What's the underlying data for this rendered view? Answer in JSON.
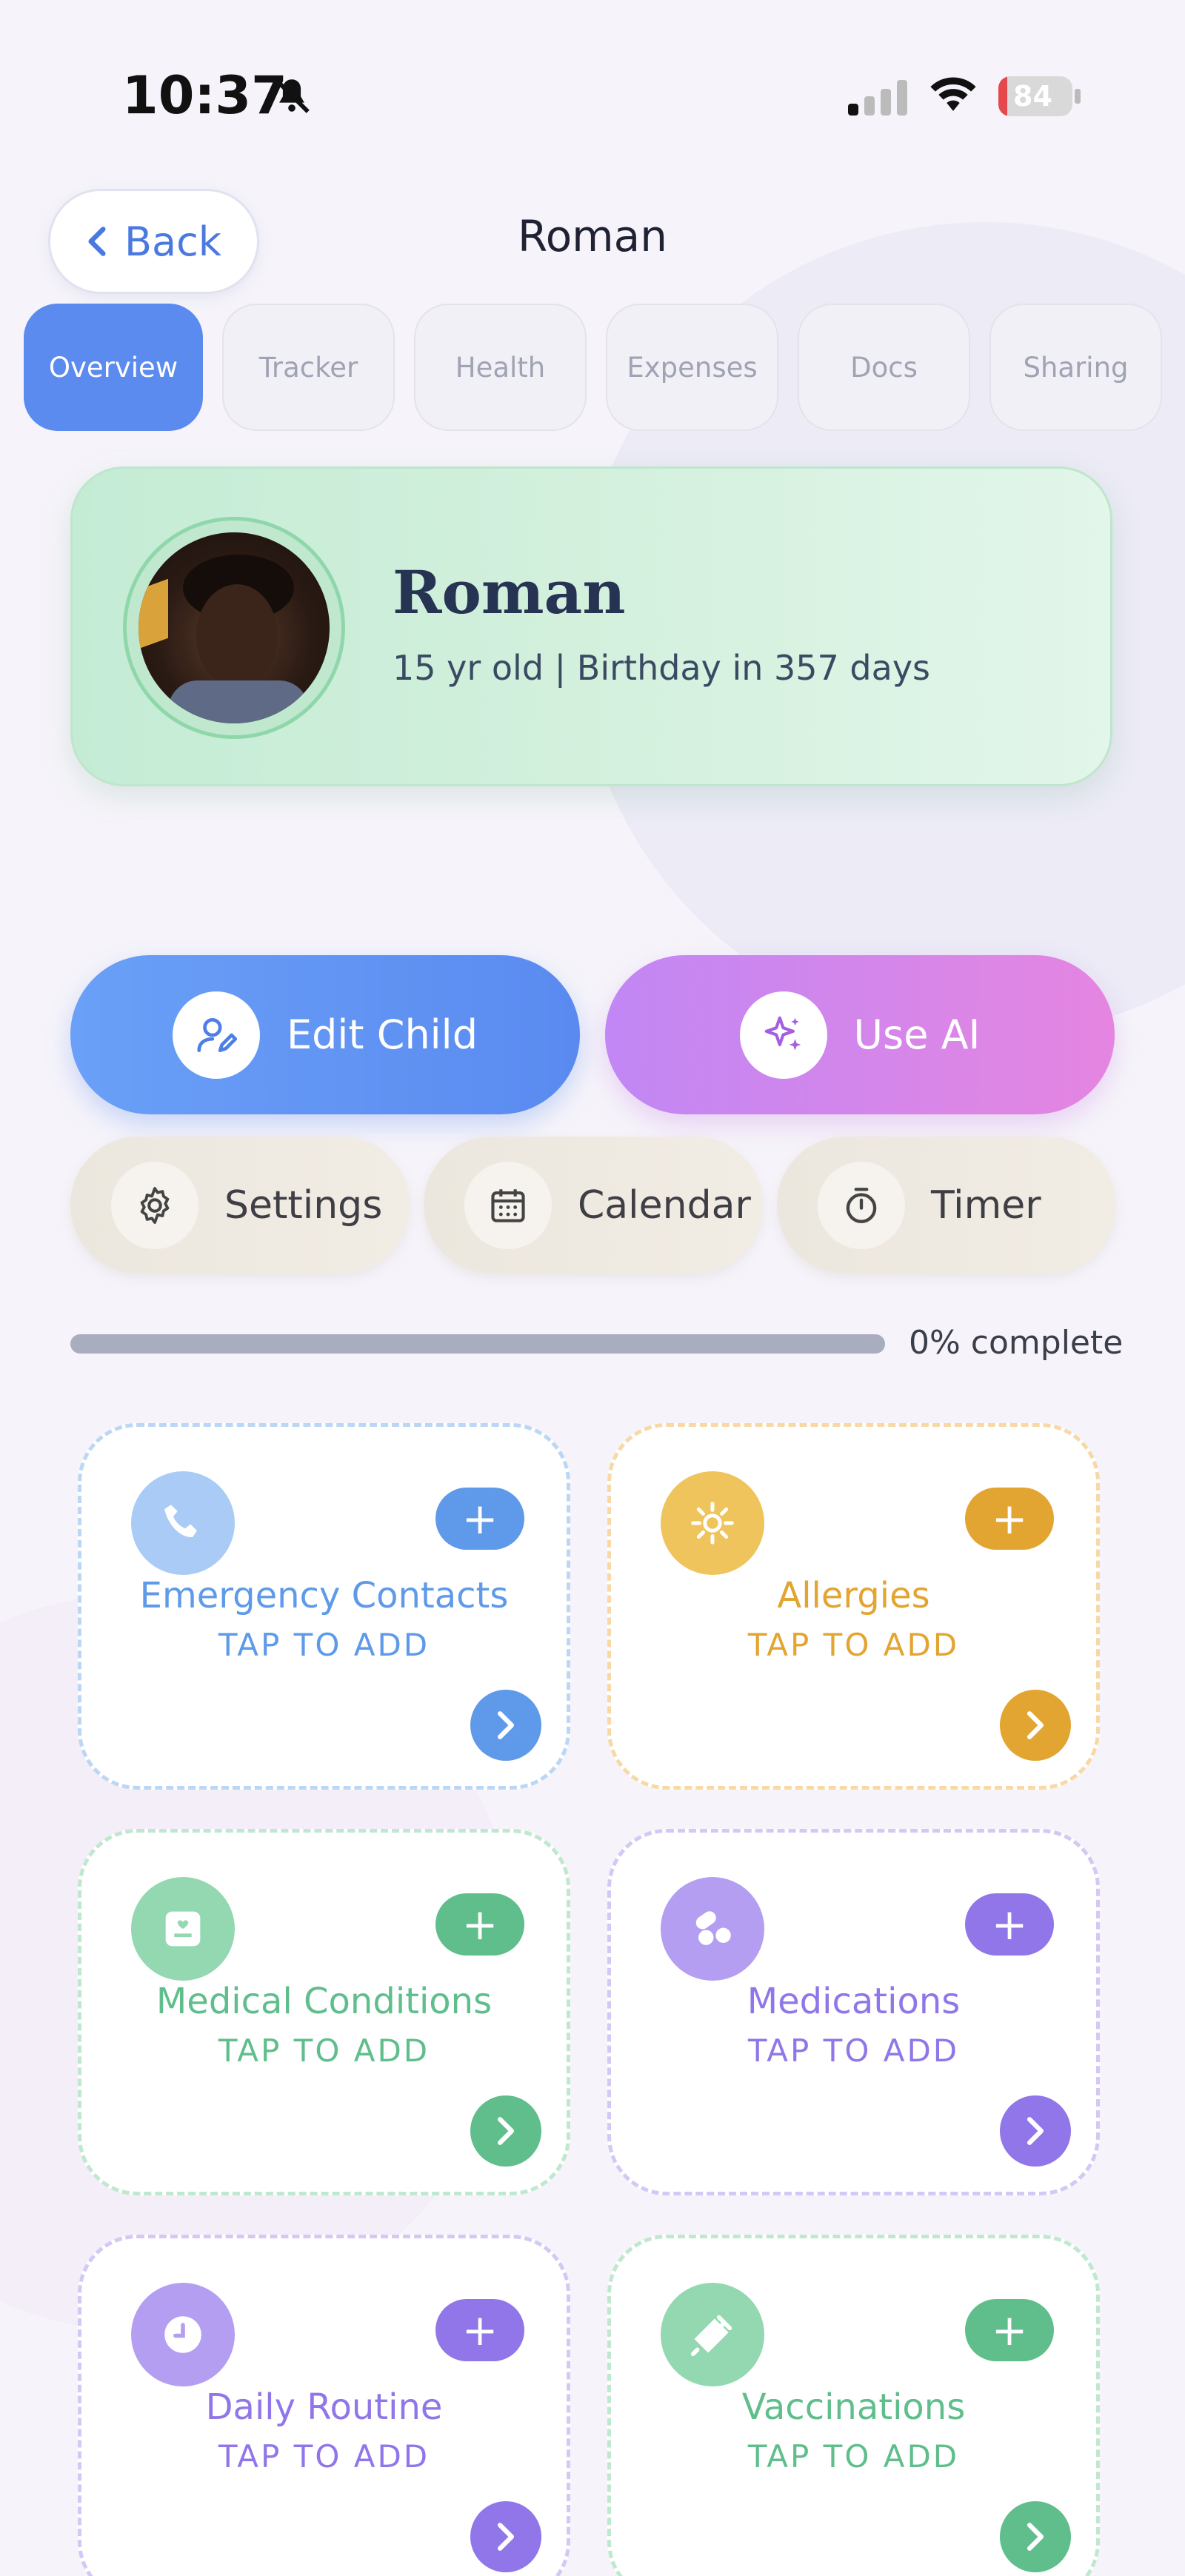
{
  "status_bar": {
    "time": "10:37",
    "battery": "84"
  },
  "header": {
    "back_label": "Back",
    "title": "Roman"
  },
  "tabs": [
    {
      "label": "Overview",
      "active": true
    },
    {
      "label": "Tracker",
      "active": false
    },
    {
      "label": "Health",
      "active": false
    },
    {
      "label": "Expenses",
      "active": false
    },
    {
      "label": "Docs",
      "active": false
    },
    {
      "label": "Sharing",
      "active": false
    }
  ],
  "profile": {
    "name": "Roman",
    "info": "15 yr old | Birthday in 357 days"
  },
  "actions": {
    "edit_child": "Edit Child",
    "use_ai": "Use AI"
  },
  "quick_links": {
    "settings": "Settings",
    "calendar": "Calendar",
    "timer": "Timer"
  },
  "progress": {
    "value": 0,
    "label": "0% complete"
  },
  "cards": [
    {
      "title": "Emergency Contacts",
      "subtitle": "TAP TO ADD",
      "icon": "phone-icon",
      "color": "#5e9ae9",
      "icon_bg": "#a9cbf6",
      "border": "#bcd7f4"
    },
    {
      "title": "Allergies",
      "subtitle": "TAP TO ADD",
      "icon": "allergen-icon",
      "color": "#e3a531",
      "icon_bg": "#f0c45c",
      "border": "#f8d9a6"
    },
    {
      "title": "Medical Conditions",
      "subtitle": "TAP TO ADD",
      "icon": "medical-record-icon",
      "color": "#5fbe8b",
      "icon_bg": "#93d8b0",
      "border": "#bfe8cf"
    },
    {
      "title": "Medications",
      "subtitle": "TAP TO ADD",
      "icon": "pills-icon",
      "color": "#9076e8",
      "icon_bg": "#b39ef1",
      "border": "#d4c8f4"
    },
    {
      "title": "Daily Routine",
      "subtitle": "TAP TO ADD",
      "icon": "clock-icon",
      "color": "#9076e8",
      "icon_bg": "#b39ef1",
      "border": "#d4c8f4"
    },
    {
      "title": "Vaccinations",
      "subtitle": "TAP TO ADD",
      "icon": "syringe-icon",
      "color": "#5fbe8b",
      "icon_bg": "#93d8b0",
      "border": "#bfe8cf"
    }
  ],
  "colors": {
    "accent": "#5b8bef",
    "ai": "#d186ea"
  }
}
